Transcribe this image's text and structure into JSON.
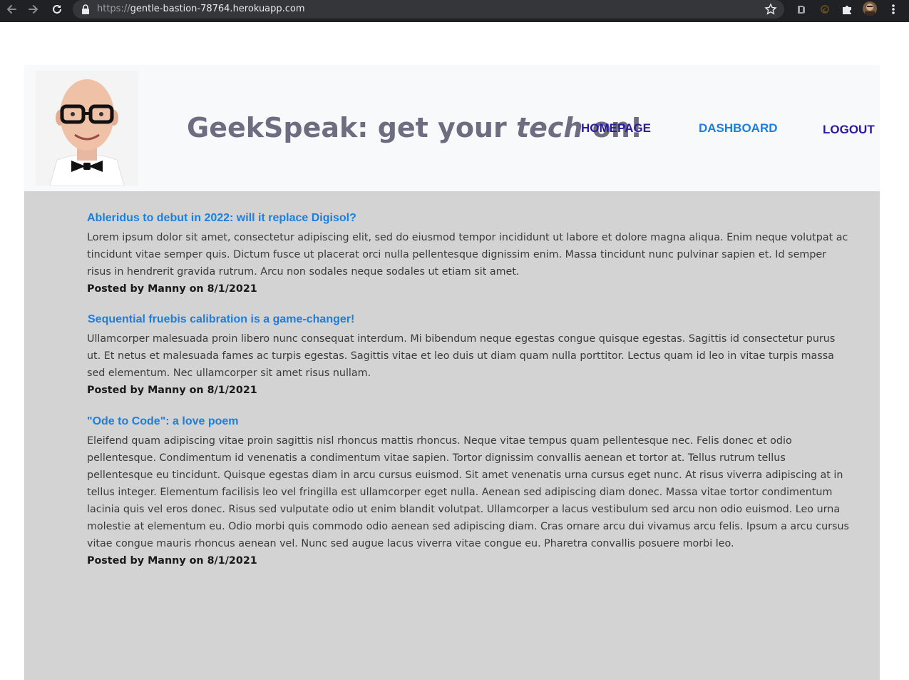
{
  "browser": {
    "url_scheme": "https://",
    "url_host": "gentle-bastion-78764.herokuapp.com",
    "icons": [
      "back-arrow-icon",
      "forward-arrow-icon",
      "reload-icon",
      "lock-icon",
      "star-icon",
      "extension-icon",
      "puzzle-icon",
      "profile-avatar",
      "kebab-menu-icon"
    ]
  },
  "header": {
    "title_prefix": "GeekSpeak: get your ",
    "title_emphasis": "tech",
    "title_suffix": " on!",
    "nav": {
      "homepage": "HOMEPAGE",
      "dashboard": "DASHBOARD",
      "logout": "LOGOUT"
    },
    "colors": {
      "title": "#6c6d80",
      "nav_visited": "#2a1aa0",
      "nav_link": "#1a7fe0",
      "header_bg": "#f8f9fa"
    }
  },
  "posts": [
    {
      "title": "Ableridus to debut in 2022: will it replace Digisol?",
      "body": "Lorem ipsum dolor sit amet, consectetur adipiscing elit, sed do eiusmod tempor incididunt ut labore et dolore magna aliqua. Enim neque volutpat ac tincidunt vitae semper quis. Dictum fusce ut placerat orci nulla pellentesque dignissim enim. Massa tincidunt nunc pulvinar sapien et. Id semper risus in hendrerit gravida rutrum. Arcu non sodales neque sodales ut etiam sit amet.",
      "meta": "Posted by Manny on 8/1/2021"
    },
    {
      "title": "Sequential fruebis calibration is a game-changer!",
      "body": "Ullamcorper malesuada proin libero nunc consequat interdum. Mi bibendum neque egestas congue quisque egestas. Sagittis id consectetur purus ut. Et netus et malesuada fames ac turpis egestas. Sagittis vitae et leo duis ut diam quam nulla porttitor. Lectus quam id leo in vitae turpis massa sed elementum. Nec ullamcorper sit amet risus nullam.",
      "meta": "Posted by Manny on 8/1/2021"
    },
    {
      "title": "\"Ode to Code\": a love poem",
      "body": "Eleifend quam adipiscing vitae proin sagittis nisl rhoncus mattis rhoncus. Neque vitae tempus quam pellentesque nec. Felis donec et odio pellentesque. Condimentum id venenatis a condimentum vitae sapien. Tortor dignissim convallis aenean et tortor at. Tellus rutrum tellus pellentesque eu tincidunt. Quisque egestas diam in arcu cursus euismod. Sit amet venenatis urna cursus eget nunc. At risus viverra adipiscing at in tellus integer. Elementum facilisis leo vel fringilla est ullamcorper eget nulla. Aenean sed adipiscing diam donec. Massa vitae tortor condimentum lacinia quis vel eros donec. Risus sed vulputate odio ut enim blandit volutpat. Ullamcorper a lacus vestibulum sed arcu non odio euismod. Leo urna molestie at elementum eu. Odio morbi quis commodo odio aenean sed adipiscing diam. Cras ornare arcu dui vivamus arcu felis. Ipsum a arcu cursus vitae congue mauris rhoncus aenean vel. Nunc sed augue lacus viverra vitae congue eu. Pharetra convallis posuere morbi leo.",
      "meta": "Posted by Manny on 8/1/2021"
    }
  ]
}
